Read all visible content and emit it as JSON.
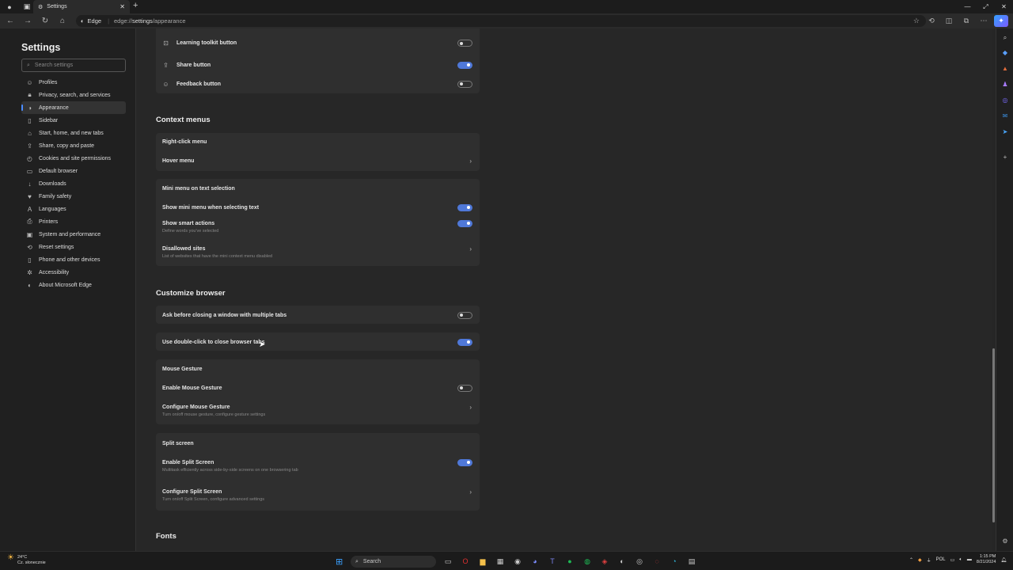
{
  "window": {
    "tab_title": "Settings",
    "address_chip": "Edge",
    "url_prefix": "edge://",
    "url_strong": "settings",
    "url_suffix": "/appearance"
  },
  "settings_nav": {
    "title": "Settings",
    "search_placeholder": "Search settings",
    "items": [
      {
        "label": "Profiles",
        "icon": "profile-icon"
      },
      {
        "label": "Privacy, search, and services",
        "icon": "lock-icon"
      },
      {
        "label": "Appearance",
        "icon": "appearance-icon",
        "active": true
      },
      {
        "label": "Sidebar",
        "icon": "sidebar-icon"
      },
      {
        "label": "Start, home, and new tabs",
        "icon": "home-icon"
      },
      {
        "label": "Share, copy and paste",
        "icon": "share-icon"
      },
      {
        "label": "Cookies and site permissions",
        "icon": "cookie-icon"
      },
      {
        "label": "Default browser",
        "icon": "browser-icon"
      },
      {
        "label": "Downloads",
        "icon": "download-icon"
      },
      {
        "label": "Family safety",
        "icon": "family-icon"
      },
      {
        "label": "Languages",
        "icon": "language-icon"
      },
      {
        "label": "Printers",
        "icon": "printer-icon"
      },
      {
        "label": "System and performance",
        "icon": "system-icon"
      },
      {
        "label": "Reset settings",
        "icon": "reset-icon"
      },
      {
        "label": "Phone and other devices",
        "icon": "phone-icon"
      },
      {
        "label": "Accessibility",
        "icon": "accessibility-icon"
      },
      {
        "label": "About Microsoft Edge",
        "icon": "edge-icon"
      }
    ]
  },
  "toolbar_buttons": {
    "learning_toolkit": {
      "label": "Learning toolkit button",
      "on": false
    },
    "share": {
      "label": "Share button",
      "on": true
    },
    "feedback": {
      "label": "Feedback button",
      "on": false
    }
  },
  "context_menus": {
    "heading": "Context menus",
    "right_click": "Right-click menu",
    "hover_menu": "Hover menu",
    "mini_menu_heading": "Mini menu on text selection",
    "show_mini_menu": {
      "label": "Show mini menu when selecting text",
      "on": true
    },
    "smart_actions": {
      "label": "Show smart actions",
      "sub": "Define words you've selected",
      "on": true
    },
    "disallowed_sites": {
      "label": "Disallowed sites",
      "sub": "List of websites that have the mini context menu disabled"
    }
  },
  "customize_browser": {
    "heading": "Customize browser",
    "ask_before_closing": {
      "label": "Ask before closing a window with multiple tabs",
      "on": false
    },
    "double_click_close": {
      "label": "Use double-click to close browser tabs",
      "on": true
    },
    "mouse_gesture_heading": "Mouse Gesture",
    "enable_mouse_gesture": {
      "label": "Enable Mouse Gesture",
      "on": false
    },
    "configure_mouse_gesture": {
      "label": "Configure Mouse Gesture",
      "sub": "Turn on/off mouse gesture, configure gesture settings"
    },
    "split_screen_heading": "Split screen",
    "enable_split_screen": {
      "label": "Enable Split Screen",
      "sub": "Multitask efficiently across side-by-side screens on one browsering tab",
      "on": true
    },
    "configure_split_screen": {
      "label": "Configure Split Screen",
      "sub": "Turn on/off Split Screen, configure advanced settings"
    }
  },
  "fonts_heading": "Fonts",
  "taskbar": {
    "temperature": "24°C",
    "weather_desc": "Cz. słonecznie",
    "search_label": "Search",
    "language": "POL",
    "time": "1:15 PM",
    "date": "8/21/2024"
  },
  "colors": {
    "accent": "#4f78d8",
    "background": "#272727",
    "card": "#2f2f2f"
  }
}
